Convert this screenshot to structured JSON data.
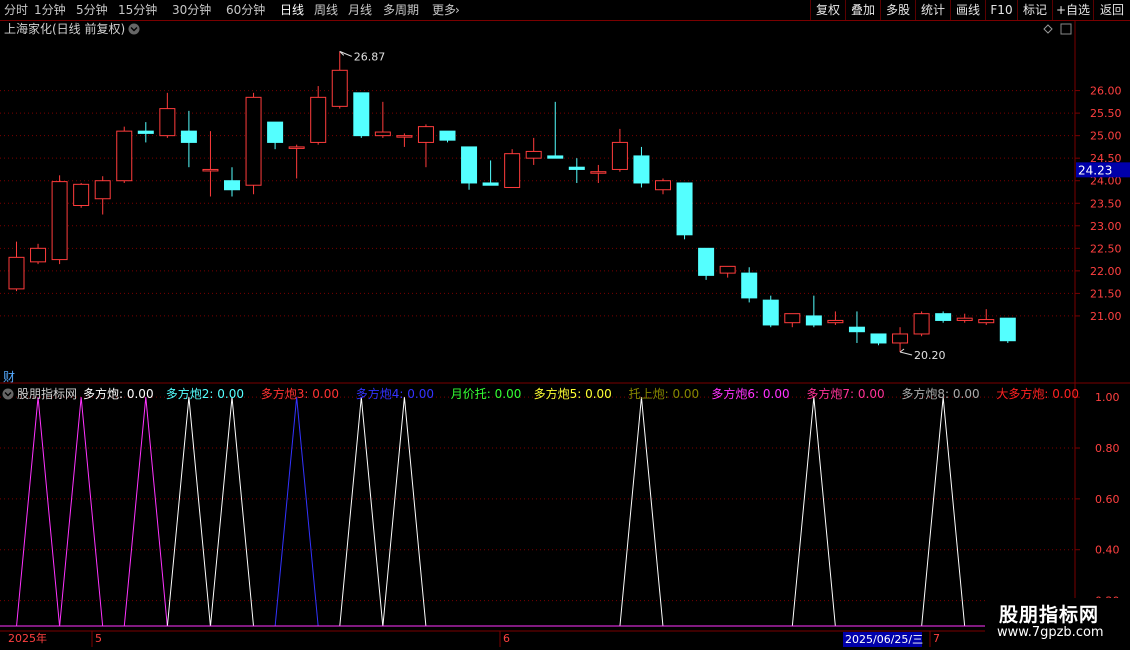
{
  "toolbar": {
    "periods": [
      "分时",
      "1分钟",
      "5分钟",
      "15分钟",
      "30分钟",
      "60分钟",
      "日线",
      "周线",
      "月线",
      "多周期",
      "更多"
    ],
    "active": "日线",
    "more_arrow": "chevron-right-icon",
    "right": [
      "复权",
      "叠加",
      "多股",
      "统计",
      "画线",
      "F10",
      "标记",
      "+自选",
      "返回"
    ]
  },
  "main": {
    "title": "上海家化(日线 前复权)",
    "title_icon": "chevron-down-icon",
    "top_right_icon": "diamond-icon",
    "high_label": "26.87",
    "low_label": "20.20",
    "current_price": "24.23",
    "side_marker": "财"
  },
  "indicator": {
    "name": "股朋指标网",
    "items": [
      {
        "label": "多方炮:",
        "value": "0.00",
        "color": "#ffffff"
      },
      {
        "label": "多方炮2:",
        "value": "0.00",
        "color": "#55ffff"
      },
      {
        "label": "多方炮3:",
        "value": "0.00",
        "color": "#ff3333"
      },
      {
        "label": "多方炮4:",
        "value": "0.00",
        "color": "#3333ff"
      },
      {
        "label": "月价托:",
        "value": "0.00",
        "color": "#33ff33"
      },
      {
        "label": "多方炮5:",
        "value": "0.00",
        "color": "#ffff33"
      },
      {
        "label": "托上炮:",
        "value": "0.00",
        "color": "#888800"
      },
      {
        "label": "多方炮6:",
        "value": "0.00",
        "color": "#ff33ff"
      },
      {
        "label": "多方炮7:",
        "value": "0.00",
        "color": "#ff3399"
      },
      {
        "label": "多方炮8:",
        "value": "0.00",
        "color": "#aaaaaa"
      },
      {
        "label": "大多方炮:",
        "value": "0.00",
        "color": "#ff2222"
      }
    ]
  },
  "date_axis": {
    "labels": [
      "2025年",
      "5",
      "6",
      "2025/06/25/三",
      "7"
    ]
  },
  "watermark": {
    "line1": "股朋指标网",
    "line2": "www.7gpzb.com"
  },
  "colors": {
    "up": "#ff3c3c",
    "down": "#54ffff",
    "grid": "#7a0000",
    "axis_text": "#ff4040",
    "current_bg": "#0000aa"
  },
  "chart_data": [
    {
      "type": "candlestick",
      "title": "上海家化(日线 前复权)",
      "ylim": [
        20.0,
        27.1
      ],
      "y_ticks": [
        21.0,
        21.5,
        22.0,
        22.5,
        23.0,
        23.5,
        24.0,
        24.5,
        25.0,
        25.5,
        26.0
      ],
      "y_tick_labels": [
        "21.00",
        "21.50",
        "22.00",
        "22.50",
        "23.00",
        "23.50",
        "24.00",
        "24.50",
        "25.00",
        "25.50",
        "26.00"
      ],
      "candles": [
        {
          "o": 21.6,
          "h": 22.65,
          "l": 21.55,
          "c": 22.3
        },
        {
          "o": 22.2,
          "h": 22.6,
          "l": 22.15,
          "c": 22.5
        },
        {
          "o": 22.25,
          "h": 24.12,
          "l": 22.15,
          "c": 23.98
        },
        {
          "o": 23.45,
          "h": 23.95,
          "l": 23.4,
          "c": 23.92
        },
        {
          "o": 23.6,
          "h": 24.1,
          "l": 23.25,
          "c": 24.0
        },
        {
          "o": 24.0,
          "h": 25.2,
          "l": 23.95,
          "c": 25.1
        },
        {
          "o": 25.1,
          "h": 25.3,
          "l": 24.85,
          "c": 25.05
        },
        {
          "o": 25.0,
          "h": 25.95,
          "l": 24.95,
          "c": 25.6
        },
        {
          "o": 25.1,
          "h": 25.55,
          "l": 24.3,
          "c": 24.85
        },
        {
          "o": 24.25,
          "h": 25.1,
          "l": 23.65,
          "c": 24.25
        },
        {
          "o": 24.0,
          "h": 24.3,
          "l": 23.65,
          "c": 23.8
        },
        {
          "o": 23.9,
          "h": 25.95,
          "l": 23.7,
          "c": 25.85
        },
        {
          "o": 25.3,
          "h": 25.3,
          "l": 24.7,
          "c": 24.85
        },
        {
          "o": 24.75,
          "h": 24.8,
          "l": 24.05,
          "c": 24.75
        },
        {
          "o": 24.85,
          "h": 26.1,
          "l": 24.8,
          "c": 25.85
        },
        {
          "o": 25.65,
          "h": 26.87,
          "l": 25.6,
          "c": 26.45
        },
        {
          "o": 25.95,
          "h": 25.95,
          "l": 24.95,
          "c": 25.0
        },
        {
          "o": 25.0,
          "h": 25.75,
          "l": 24.95,
          "c": 25.08
        },
        {
          "o": 25.0,
          "h": 25.05,
          "l": 24.75,
          "c": 25.0
        },
        {
          "o": 24.85,
          "h": 25.25,
          "l": 24.3,
          "c": 25.2
        },
        {
          "o": 25.1,
          "h": 25.1,
          "l": 24.85,
          "c": 24.9
        },
        {
          "o": 24.75,
          "h": 24.75,
          "l": 23.8,
          "c": 23.95
        },
        {
          "o": 23.95,
          "h": 24.45,
          "l": 23.9,
          "c": 23.9
        },
        {
          "o": 23.85,
          "h": 24.7,
          "l": 23.85,
          "c": 24.6
        },
        {
          "o": 24.5,
          "h": 24.95,
          "l": 24.35,
          "c": 24.65
        },
        {
          "o": 24.55,
          "h": 25.75,
          "l": 24.5,
          "c": 24.5
        },
        {
          "o": 24.3,
          "h": 24.5,
          "l": 23.95,
          "c": 24.25
        },
        {
          "o": 24.2,
          "h": 24.35,
          "l": 23.95,
          "c": 24.2
        },
        {
          "o": 24.25,
          "h": 25.15,
          "l": 24.2,
          "c": 24.85
        },
        {
          "o": 24.55,
          "h": 24.75,
          "l": 23.85,
          "c": 23.95
        },
        {
          "o": 23.8,
          "h": 24.05,
          "l": 23.7,
          "c": 24.0
        },
        {
          "o": 23.95,
          "h": 23.95,
          "l": 22.7,
          "c": 22.8
        },
        {
          "o": 22.5,
          "h": 22.5,
          "l": 21.8,
          "c": 21.9
        },
        {
          "o": 21.95,
          "h": 22.1,
          "l": 21.85,
          "c": 22.1
        },
        {
          "o": 21.95,
          "h": 22.08,
          "l": 21.3,
          "c": 21.4
        },
        {
          "o": 21.35,
          "h": 21.45,
          "l": 20.75,
          "c": 20.8
        },
        {
          "o": 20.85,
          "h": 21.05,
          "l": 20.75,
          "c": 21.05
        },
        {
          "o": 21.0,
          "h": 21.45,
          "l": 20.75,
          "c": 20.8
        },
        {
          "o": 20.85,
          "h": 21.1,
          "l": 20.8,
          "c": 20.9
        },
        {
          "o": 20.75,
          "h": 21.1,
          "l": 20.4,
          "c": 20.65
        },
        {
          "o": 20.6,
          "h": 20.6,
          "l": 20.35,
          "c": 20.4
        },
        {
          "o": 20.4,
          "h": 20.75,
          "l": 20.2,
          "c": 20.6
        },
        {
          "o": 20.6,
          "h": 21.1,
          "l": 20.55,
          "c": 21.05
        },
        {
          "o": 21.05,
          "h": 21.1,
          "l": 20.85,
          "c": 20.9
        },
        {
          "o": 20.9,
          "h": 21.05,
          "l": 20.85,
          "c": 20.95
        },
        {
          "o": 20.85,
          "h": 21.15,
          "l": 20.8,
          "c": 20.92
        },
        {
          "o": 20.95,
          "h": 20.95,
          "l": 20.4,
          "c": 20.45
        }
      ]
    },
    {
      "type": "line",
      "title": "股朋指标网",
      "ylim": [
        0.1,
        1.04
      ],
      "y_ticks": [
        0.2,
        0.4,
        0.6,
        0.8,
        1.0
      ],
      "y_tick_labels": [
        "0.20",
        "0.40",
        "0.60",
        "0.80",
        "1.00"
      ],
      "spike_series": [
        {
          "name": "多方炮6",
          "color": "#ff33ff",
          "peaks": [
            1,
            3,
            6
          ]
        },
        {
          "name": "多方炮",
          "color": "#ffffff",
          "peaks": [
            8,
            10
          ]
        },
        {
          "name": "多方炮4",
          "color": "#3333ff",
          "peaks": [
            13
          ]
        },
        {
          "name": "多方炮",
          "color": "#ffffff",
          "peaks": [
            16,
            18,
            29,
            37,
            43
          ]
        }
      ],
      "peak_value": 1.0,
      "candle_count": 47
    }
  ]
}
